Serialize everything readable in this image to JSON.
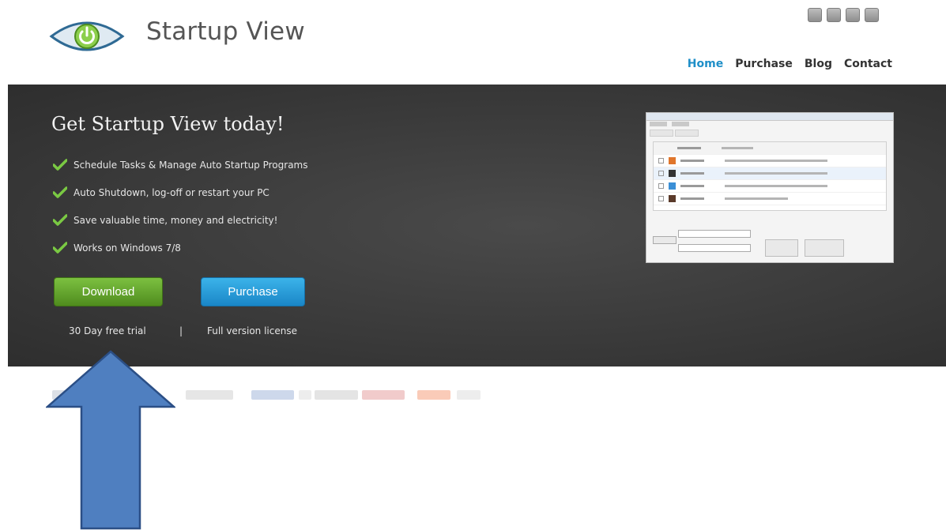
{
  "header": {
    "brand": "Startup View",
    "logo_icon": "power-eye-logo-icon",
    "social_icons": [
      "social-icon-1",
      "social-icon-2",
      "social-icon-3",
      "social-icon-4"
    ]
  },
  "nav": {
    "items": [
      {
        "label": "Home",
        "active": true
      },
      {
        "label": "Purchase",
        "active": false
      },
      {
        "label": "Blog",
        "active": false
      },
      {
        "label": "Contact",
        "active": false
      }
    ]
  },
  "hero": {
    "title": "Get Startup View today!",
    "features": [
      "Schedule Tasks & Manage Auto Startup Programs",
      "Auto Shutdown, log-off or restart your PC",
      "Save valuable time, money and electricity!",
      "Works on Windows 7/8"
    ],
    "feature_icon": "green-checkmark-icon",
    "download_button": "Download",
    "purchase_button": "Purchase",
    "download_caption": "30 Day free trial",
    "caption_separator": "|",
    "purchase_caption": "Full version license"
  },
  "annotation": {
    "arrow_icon": "up-arrow-icon",
    "color": "#4f7fc0"
  },
  "colors": {
    "nav_active": "#1f8fc8",
    "download_green": "#6aad32",
    "purchase_blue": "#2ba2de",
    "hero_bg": "#3c3c3c",
    "check_green": "#7ac943"
  }
}
